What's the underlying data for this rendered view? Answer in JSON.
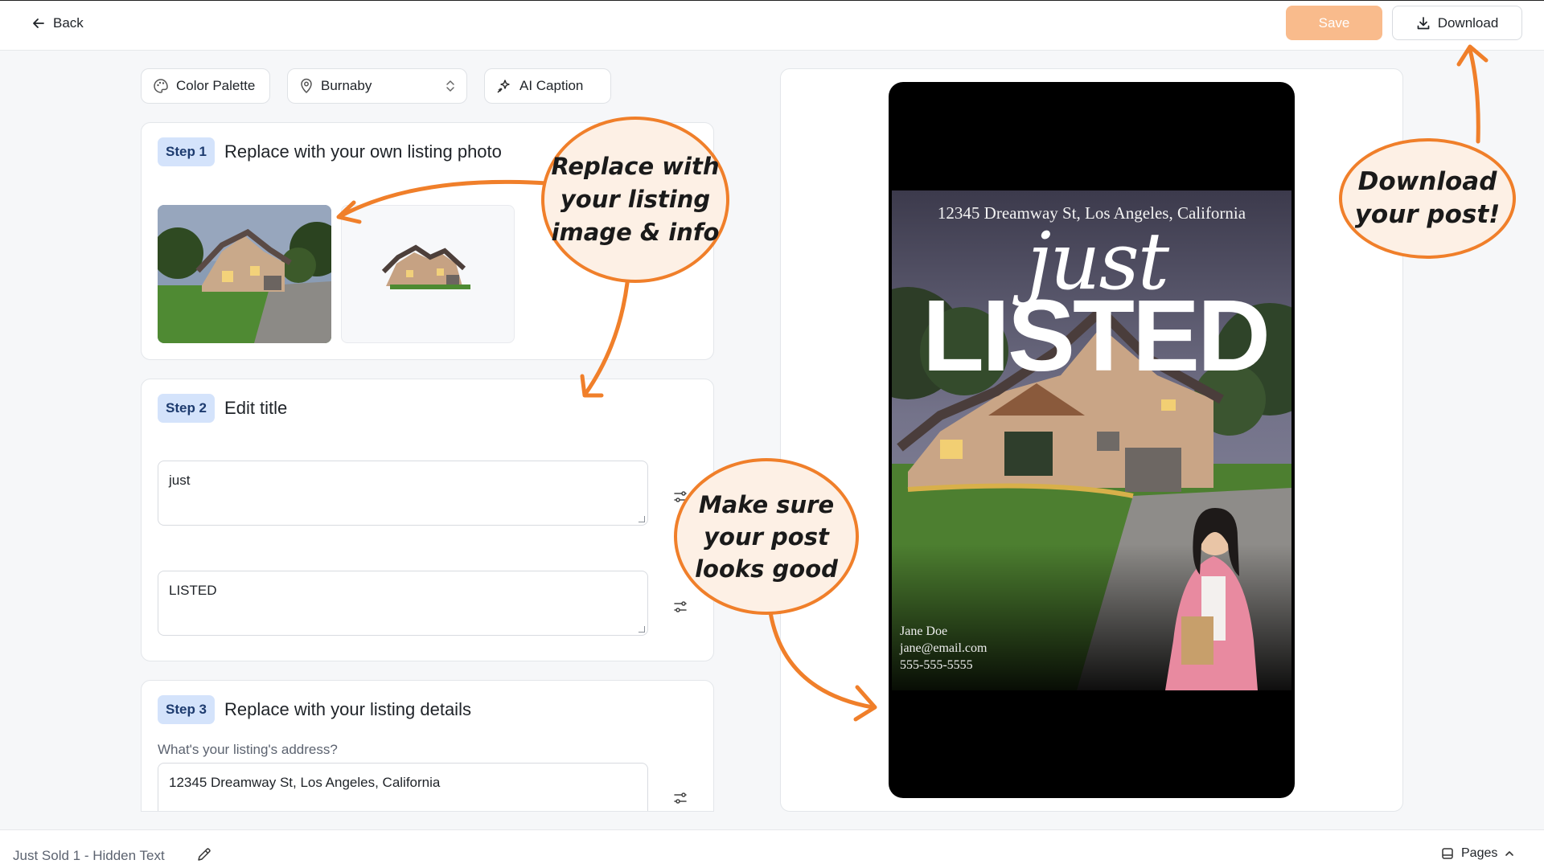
{
  "header": {
    "back_label": "Back",
    "save_label": "Save",
    "download_label": "Download"
  },
  "toolbar": {
    "palette_label": "Color Palette",
    "location_value": "Burnaby",
    "ai_label": "AI Caption"
  },
  "steps": {
    "step1": {
      "badge": "Step 1",
      "title": "Replace with your own listing photo"
    },
    "step2": {
      "badge": "Step 2",
      "title": "Edit title",
      "field1_value": "just",
      "field2_value": "LISTED"
    },
    "step3": {
      "badge": "Step 3",
      "title": "Replace with your listing details",
      "address_label": "What's your listing's address?",
      "address_value": "12345 Dreamway St, Los Angeles, California"
    }
  },
  "preview": {
    "address": "12345 Dreamway St, Los Angeles, California",
    "title_script": "just",
    "title_main": "LISTED",
    "agent_name": "Jane Doe",
    "agent_email": "jane@email.com",
    "agent_phone": "555-555-5555"
  },
  "annotations": {
    "replace": "Replace with\nyour listing\nimage & info",
    "check": "Make sure\nyour post\nlooks good",
    "download": "Download\nyour post!"
  },
  "footer": {
    "doc_name": "Just Sold 1 - Hidden Text",
    "pages_label": "Pages"
  },
  "colors": {
    "accent_orange": "#f07f2a",
    "save_disabled": "#f9bb8c",
    "step_badge_bg": "#d4e3fb"
  }
}
